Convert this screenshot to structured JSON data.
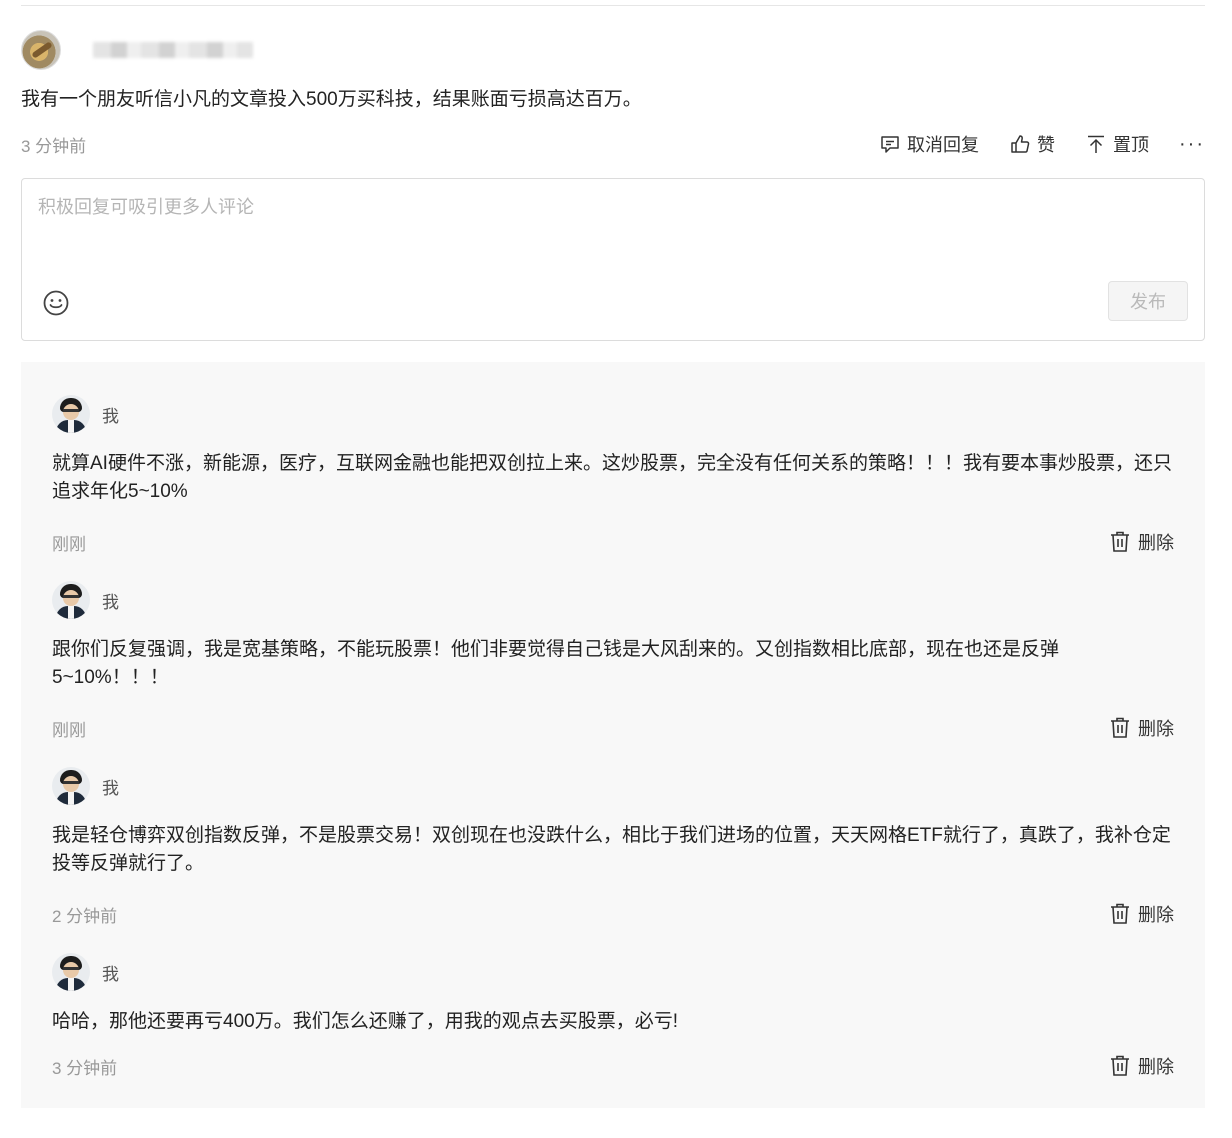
{
  "comment": {
    "author_prefix": "ﾠ",
    "text": "我有一个朋友听信小凡的文章投入500万买科技，结果账面亏损高达百万。",
    "time": "3 分钟前",
    "actions": {
      "cancel_reply": "取消回复",
      "like": "赞",
      "pin": "置顶",
      "more": "···"
    }
  },
  "reply_box": {
    "placeholder": "积极回复可吸引更多人评论",
    "publish": "发布"
  },
  "replies": [
    {
      "author": "我",
      "text": "就算AI硬件不涨，新能源，医疗，互联网金融也能把双创拉上来。这炒股票，完全没有任何关系的策略！！！我有要本事炒股票，还只追求年化5~10%",
      "time": "刚刚",
      "delete": "删除"
    },
    {
      "author": "我",
      "text": "跟你们反复强调，我是宽基策略，不能玩股票！他们非要觉得自己钱是大风刮来的。又创指数相比底部，现在也还是反弹5~10%！！！",
      "time": "刚刚",
      "delete": "删除"
    },
    {
      "author": "我",
      "text": "我是轻仓博弈双创指数反弹，不是股票交易！双创现在也没跌什么，相比于我们进场的位置，天天网格ETF就行了，真跌了，我补仓定投等反弹就行了。",
      "time": "2 分钟前",
      "delete": "删除"
    },
    {
      "author": "我",
      "text": "哈哈，那他还要再亏400万。我们怎么还赚了，用我的观点去买股票，必亏!",
      "time": "3 分钟前",
      "delete": "删除"
    }
  ]
}
